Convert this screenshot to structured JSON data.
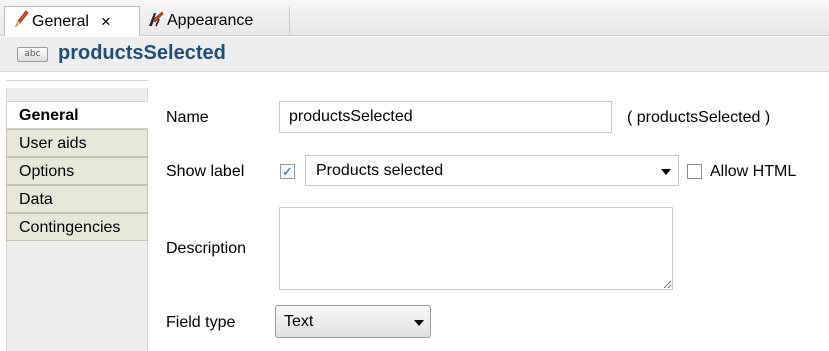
{
  "tabs": [
    {
      "label": "General",
      "active": true,
      "close_glyph": "×",
      "icon": "pencil-icon"
    },
    {
      "label": "Appearance",
      "active": false,
      "icon": "paint-brush-icon"
    }
  ],
  "header": {
    "badge_text": "abc",
    "title": "productsSelected"
  },
  "sidebar": {
    "items": [
      {
        "label": "General",
        "active": true
      },
      {
        "label": "User aids",
        "active": false
      },
      {
        "label": "Options",
        "active": false
      },
      {
        "label": "Data",
        "active": false
      },
      {
        "label": "Contingencies",
        "active": false
      }
    ]
  },
  "form": {
    "name": {
      "label": "Name",
      "value": "productsSelected",
      "echo": "( productsSelected )"
    },
    "show_label": {
      "label": "Show label",
      "checked": true,
      "value": "Products selected"
    },
    "allow_html": {
      "label": "Allow HTML",
      "checked": false
    },
    "description": {
      "label": "Description",
      "value": ""
    },
    "field_type": {
      "label": "Field type",
      "value": "Text"
    }
  },
  "colors": {
    "title": "#1f4e79",
    "nav_bg": "#e7e7da",
    "check": "#2b5bb5"
  }
}
